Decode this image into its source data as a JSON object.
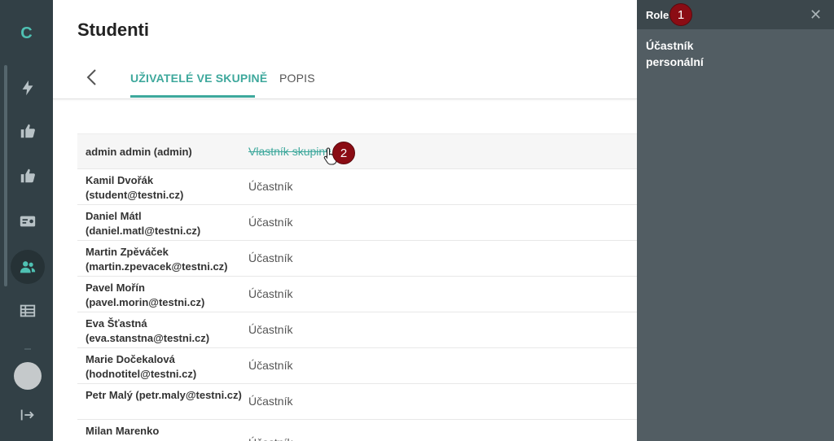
{
  "sidebar": {
    "logo": "C",
    "items": [
      {
        "icon": "bolt-icon"
      },
      {
        "icon": "thumbs-up-icon"
      },
      {
        "icon": "thumbs-up-icon"
      },
      {
        "icon": "id-card-icon"
      },
      {
        "icon": "users-icon",
        "active": true
      },
      {
        "icon": "table-icon"
      }
    ],
    "logout_icon": "logout-icon"
  },
  "header": {
    "title": "Studenti",
    "tabs": [
      {
        "label": "UŽIVATELÉ VE SKUPINĚ",
        "active": true
      },
      {
        "label": "POPIS"
      }
    ]
  },
  "members": [
    {
      "name": "admin admin (admin)",
      "role": "Vlastník skupiny"
    },
    {
      "name": "Kamil Dvořák (student@testni.cz)",
      "role": "Účastník"
    },
    {
      "name": "Daniel Mátl (daniel.matl@testni.cz)",
      "role": "Účastník"
    },
    {
      "name": "Martin Zpěváček (martin.zpevacek@testni.cz)",
      "role": "Účastník"
    },
    {
      "name": "Pavel Mořín (pavel.morin@testni.cz)",
      "role": "Účastník"
    },
    {
      "name": "Eva Šťastná (eva.stanstna@testni.cz)",
      "role": "Účastník"
    },
    {
      "name": "Marie Dočekalová (hodnotitel@testni.cz)",
      "role": "Účastník"
    },
    {
      "name": "Petr Malý (petr.maly@testni.cz)",
      "role": "Účastník"
    },
    {
      "name": "Milan Marenko",
      "role": "Účastník"
    }
  ],
  "role_panel": {
    "title": "Role",
    "close": "✕",
    "options": [
      "Účastník",
      "personální"
    ]
  },
  "badges": [
    "1",
    "2"
  ],
  "colors": {
    "accent": "#3ea89c",
    "sidebar": "#324046",
    "panel": "#525d63",
    "badge": "#8b0c14"
  }
}
